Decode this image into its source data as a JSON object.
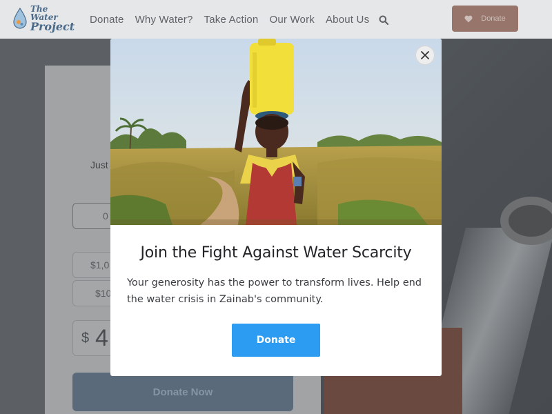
{
  "brand": {
    "logo_line1": "The Water",
    "logo_line2": "Project"
  },
  "nav": {
    "items": [
      {
        "label": "Donate"
      },
      {
        "label": "Why Water?"
      },
      {
        "label": "Take Action"
      },
      {
        "label": "Our Work"
      },
      {
        "label": "About Us"
      }
    ],
    "search_icon": "search-icon"
  },
  "header": {
    "donate_label": "Donate",
    "donate_icon": "heart-icon"
  },
  "background_page": {
    "fragment_just": "Just",
    "option_partial": "0",
    "amount_1": "$1,0",
    "amount_2": "$10",
    "currency_symbol": "$",
    "amount_value": "4",
    "donate_now_label": "Donate Now"
  },
  "modal": {
    "title": "Join the Fight Against Water Scarcity",
    "body": "Your generosity has the power to transform lives. Help end the water crisis in Zainab's community.",
    "donate_label": "Donate",
    "close_icon": "close-icon"
  },
  "colors": {
    "accent_blue": "#2c9cf2",
    "header_donate": "#98756a",
    "jerrycan_yellow": "#f2df3a"
  }
}
